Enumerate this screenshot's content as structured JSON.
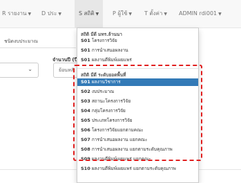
{
  "nav": {
    "items": [
      {
        "label": "R รายงาน"
      },
      {
        "label": "D ประ"
      },
      {
        "label": "S สถิติ"
      },
      {
        "label": "P ผู้ใช้"
      },
      {
        "label": "T ตั้งค่า"
      },
      {
        "label": "ADMIN rdi001"
      }
    ]
  },
  "background": {
    "left_label": "ชนิดงบประมาณ",
    "field_label": "จำนวนปี (ปีบ",
    "select_value": "ย้อนหลั"
  },
  "dropdown": {
    "group1_header": "สถิติ มีดี มทร.ล้านนา",
    "group1_items": [
      {
        "code": "S01",
        "label": "โครงการวิจัย"
      },
      {
        "code": "S01",
        "label": "การนำเสนอผลงาน"
      },
      {
        "code": "S01",
        "label": "ผลงานตีพิมพ์เผยแพร่"
      }
    ],
    "group2_header": "สถิติ มีดี ระดับยอดพื้นที่",
    "group2_items": [
      {
        "code": "S01",
        "label": "ผลงานวิชาการ"
      },
      {
        "code": "S02",
        "label": "งบประมาณ"
      },
      {
        "code": "S03",
        "label": "สถานะโครงการวิจัย"
      },
      {
        "code": "S04",
        "label": "กลุ่มโครงการวิจัย"
      },
      {
        "code": "S05",
        "label": "ประเภทโครงการวิจัย"
      },
      {
        "code": "S06",
        "label": "โครงการวิจัยแยกตามคณะ"
      },
      {
        "code": "S07",
        "label": "การนำเสนอผลงาน แยกคณะ"
      },
      {
        "code": "S08",
        "label": "การนำเสนอผลงาน แยกตามระดับคุณภาพ"
      },
      {
        "code": "S09",
        "label": "ผลงานตีพิมพ์เผยแพร่ แยกคณะ"
      },
      {
        "code": "S10",
        "label": "ผลงานตีพิมพ์เผยแพร่ แยกตามระดับคุณภาพ"
      }
    ]
  },
  "colors": {
    "active_bg": "#337ab7",
    "highlight_dash": "#e01e1e"
  }
}
